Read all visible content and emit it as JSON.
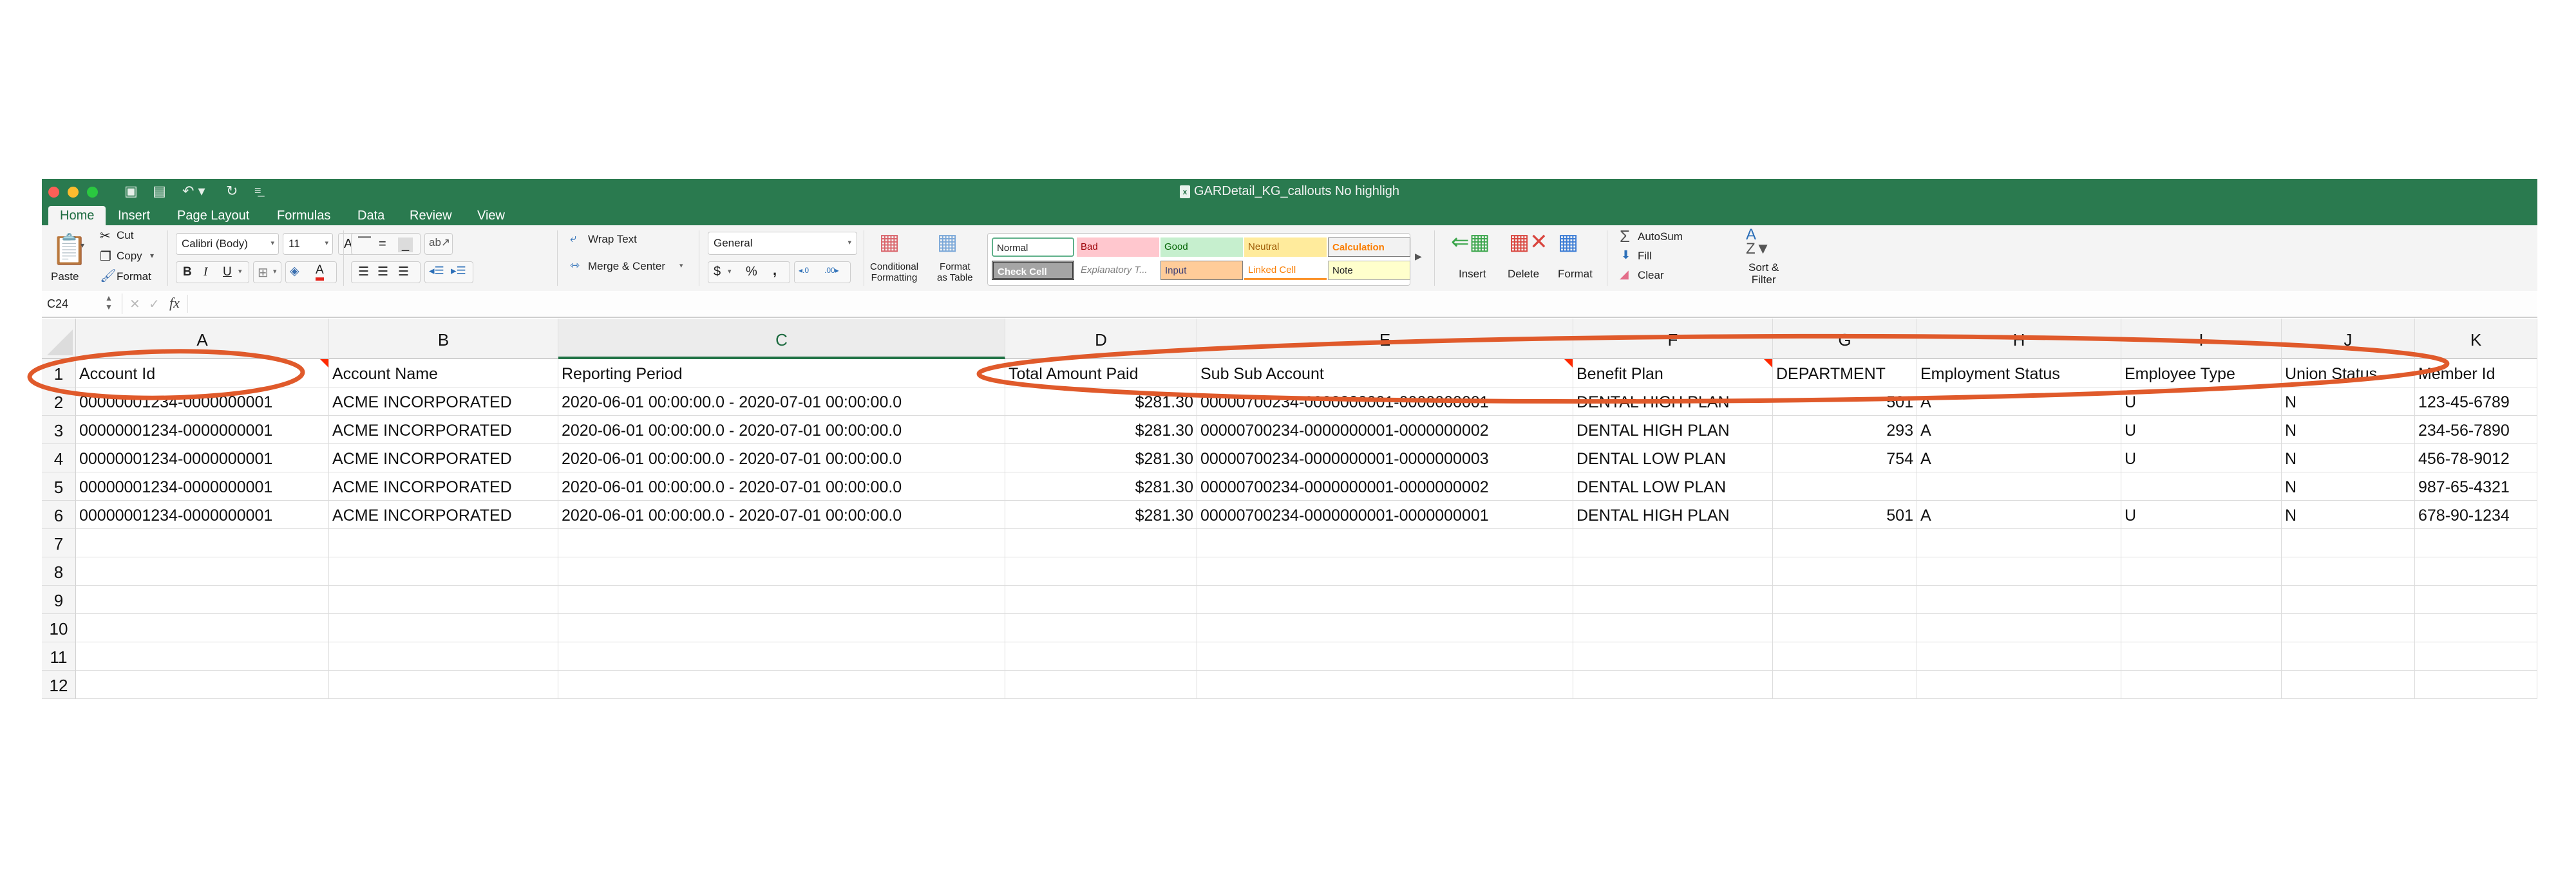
{
  "window": {
    "title": "GARDetail_KG_callouts No highligh",
    "file_icon": "excel-file-icon"
  },
  "quick_access": [
    "sidebar-toggle-icon",
    "save-icon",
    "undo-icon",
    "redo-icon",
    "customize-icon"
  ],
  "tabs": [
    {
      "label": "Home",
      "active": true
    },
    {
      "label": "Insert"
    },
    {
      "label": "Page Layout"
    },
    {
      "label": "Formulas"
    },
    {
      "label": "Data"
    },
    {
      "label": "Review"
    },
    {
      "label": "View"
    }
  ],
  "ribbon": {
    "paste": "Paste",
    "cut": "Cut",
    "copy": "Copy",
    "format_painter": "Format",
    "font_name": "Calibri (Body)",
    "font_size": "11",
    "bold": "B",
    "italic": "I",
    "underline": "U",
    "wrap_text": "Wrap Text",
    "merge_center": "Merge & Center",
    "number_format": "General",
    "currency": "$",
    "percent": "%",
    "comma": ",",
    "conditional_formatting": [
      "Conditional",
      "Formatting"
    ],
    "format_as_table": [
      "Format",
      "as Table"
    ],
    "styles": [
      {
        "label": "Normal",
        "bg": "#ffffff",
        "fg": "#000000"
      },
      {
        "label": "Bad",
        "bg": "#ffc7ce",
        "fg": "#9c0006"
      },
      {
        "label": "Good",
        "bg": "#c6efce",
        "fg": "#006100"
      },
      {
        "label": "Neutral",
        "bg": "#ffeb9c",
        "fg": "#9c5700"
      },
      {
        "label": "Calculation",
        "bg": "#f2f2f2",
        "fg": "#fa7d00"
      },
      {
        "label": "Check Cell",
        "bg": "#a5a5a5",
        "fg": "#ffffff"
      },
      {
        "label": "Explanatory T...",
        "bg": "#ffffff",
        "fg": "#7f7f7f"
      },
      {
        "label": "Input",
        "bg": "#ffcc99",
        "fg": "#3f3f76"
      },
      {
        "label": "Linked Cell",
        "bg": "#ffffff",
        "fg": "#fa7d00"
      },
      {
        "label": "Note",
        "bg": "#ffffcc",
        "fg": "#000000"
      }
    ],
    "insert": "Insert",
    "delete": "Delete",
    "format": "Format",
    "autosum": "AutoSum",
    "fill": "Fill",
    "clear": "Clear",
    "sort_filter": [
      "Sort &",
      "Filter"
    ]
  },
  "formula_bar": {
    "name_box": "C24",
    "fx": "fx",
    "value": ""
  },
  "sheet": {
    "selected_column": "C",
    "columns": [
      "A",
      "B",
      "C",
      "D",
      "E",
      "F",
      "G",
      "H",
      "I",
      "J",
      "K"
    ],
    "row_numbers": [
      "1",
      "2",
      "3",
      "4",
      "5",
      "6",
      "7",
      "8",
      "9",
      "10",
      "11",
      "12"
    ],
    "header_row": [
      "Account Id",
      "Account Name",
      "Reporting Period",
      "Total Amount Paid",
      "Sub Sub Account",
      "Benefit Plan",
      "DEPARTMENT",
      "Employment Status",
      "Employee Type",
      "Union Status",
      "Member Id"
    ],
    "comment_flags_after_columns": [
      "A",
      "E",
      "F"
    ],
    "rows": [
      [
        "00000001234-0000000001",
        "ACME INCORPORATED",
        "2020-06-01 00:00:00.0 - 2020-07-01 00:00:00.0",
        "$281.30",
        "00000700234-0000000001-0000000001",
        "DENTAL HIGH PLAN",
        "501",
        "A",
        "U",
        "N",
        "123-45-6789"
      ],
      [
        "00000001234-0000000001",
        "ACME INCORPORATED",
        "2020-06-01 00:00:00.0 - 2020-07-01 00:00:00.0",
        "$281.30",
        "00000700234-0000000001-0000000002",
        "DENTAL HIGH PLAN",
        "293",
        "A",
        "U",
        "N",
        "234-56-7890"
      ],
      [
        "00000001234-0000000001",
        "ACME INCORPORATED",
        "2020-06-01 00:00:00.0 - 2020-07-01 00:00:00.0",
        "$281.30",
        "00000700234-0000000001-0000000003",
        "DENTAL LOW PLAN",
        "754",
        "A",
        "U",
        "N",
        "456-78-9012"
      ],
      [
        "00000001234-0000000001",
        "ACME INCORPORATED",
        "2020-06-01 00:00:00.0 - 2020-07-01 00:00:00.0",
        "$281.30",
        "00000700234-0000000001-0000000002",
        "DENTAL LOW PLAN",
        "",
        "",
        "",
        "N",
        "987-65-4321"
      ],
      [
        "00000001234-0000000001",
        "ACME INCORPORATED",
        "2020-06-01 00:00:00.0 - 2020-07-01 00:00:00.0",
        "$281.30",
        "00000700234-0000000001-0000000001",
        "DENTAL HIGH PLAN",
        "501",
        "A",
        "U",
        "N",
        "678-90-1234"
      ]
    ]
  },
  "annotations": {
    "callout_color": "#e05a2b",
    "ellipses": [
      {
        "encloses": "Account Id header"
      },
      {
        "encloses": "Sub Sub Account through Union Status headers"
      }
    ]
  }
}
